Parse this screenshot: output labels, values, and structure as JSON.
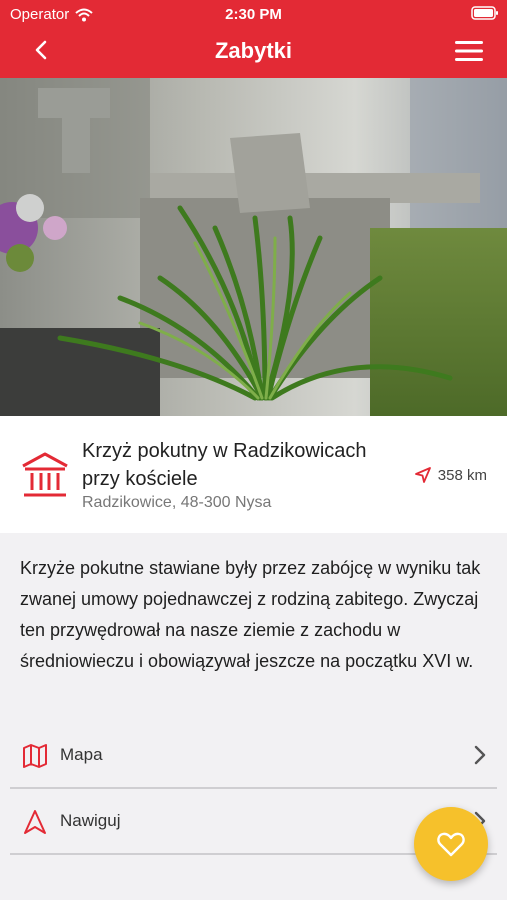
{
  "status_bar": {
    "carrier": "Operator",
    "time": "2:30 PM"
  },
  "header": {
    "title": "Zabytki"
  },
  "monument": {
    "name": "Krzyż pokutny w Radzikowicach przy kościele",
    "address": "Radzikowice, 48-300 Nysa",
    "distance": "358 km"
  },
  "description": "Krzyże pokutne stawiane były przez zabójcę w wyniku tak zwanej umowy pojednawczej z rodziną zabitego. Zwyczaj ten przywędrował na nasze ziemie z zachodu w średniowieczu i obowiązywał jeszcze na początku XVI w.",
  "actions": [
    {
      "label": "Mapa",
      "icon": "map-icon"
    },
    {
      "label": "Nawiguj",
      "icon": "navigate-icon"
    }
  ],
  "colors": {
    "accent": "#e32a35",
    "fab": "#f6c12b"
  }
}
